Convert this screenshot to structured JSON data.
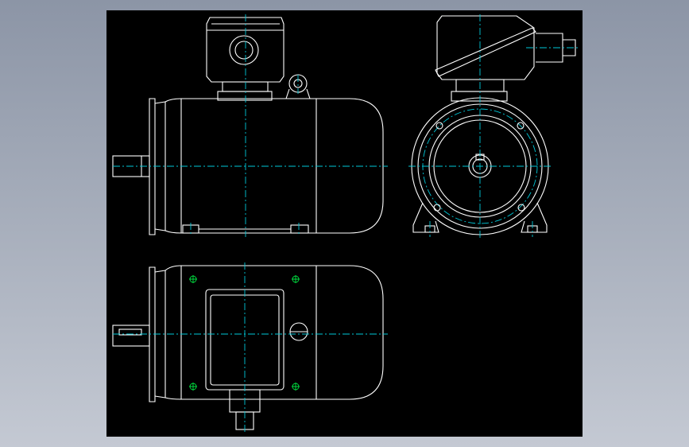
{
  "drawing": {
    "background": "#000000",
    "window_background": "#9aa2b0",
    "line_color": "#ffffff",
    "centerline_color": "#00c8d8",
    "mark_color": "#00e040",
    "views": [
      "side-elevation",
      "end-elevation",
      "plan-view"
    ],
    "labels": []
  }
}
